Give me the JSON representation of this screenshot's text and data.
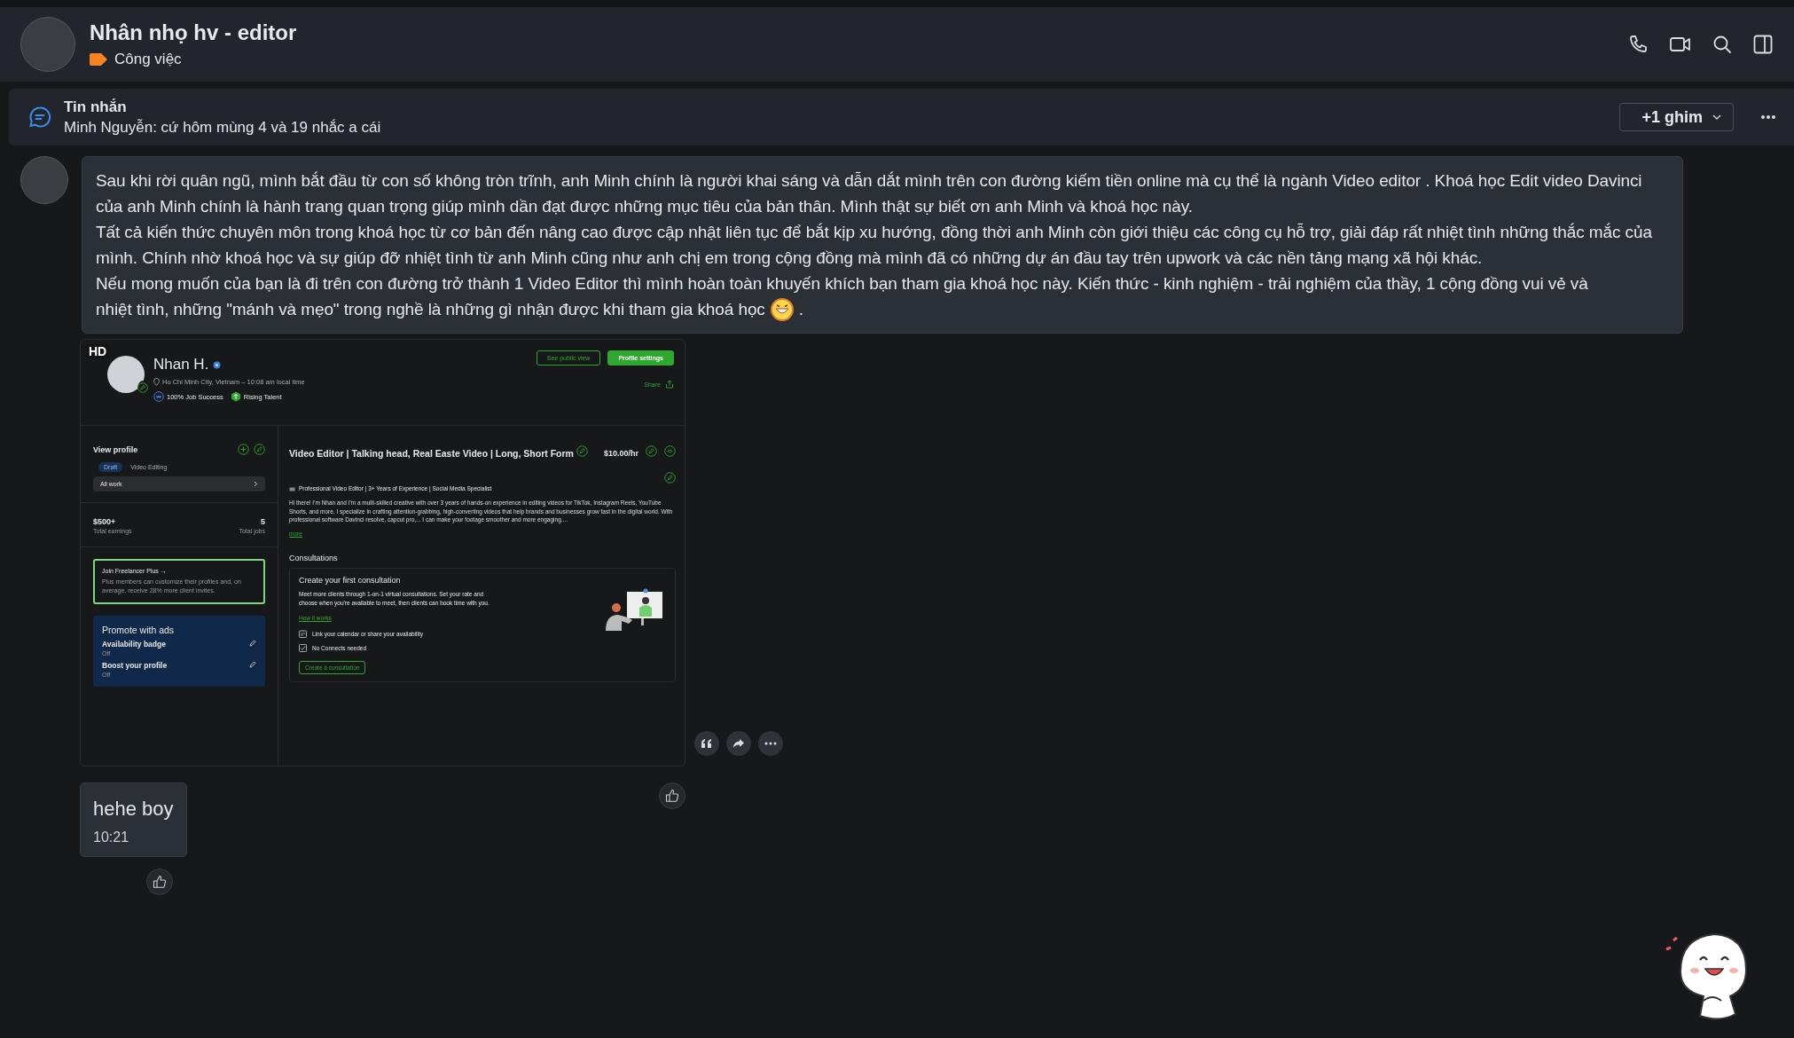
{
  "header": {
    "title": "Nhân nhọ hv - editor",
    "tag": {
      "label": "Công việc",
      "color": "#f5841f"
    }
  },
  "pinned": {
    "title": "Tin nhắn",
    "preview": "Minh Nguyễn: cứ hôm mùng 4 và 19 nhắc a cái",
    "more_pins": "+1 ghim"
  },
  "messages": [
    {
      "kind": "text",
      "paragraphs": [
        "Sau khi rời quân ngũ, mình bắt đầu từ con số không tròn trĩnh, anh Minh chính là người khai sáng và dẫn dắt mình trên con đường kiếm tiền online mà cụ thể là ngành Video editor . Khoá học Edit video Davinci của anh Minh chính là hành trang quan trọng giúp mình dần đạt được những mục tiêu của bản thân. Mình thật sự biết ơn anh Minh và khoá học này.",
        "Tất cả kiến thức chuyên môn trong khoá học từ cơ bản đến nâng cao được cập nhật liên tục để bắt kịp xu hướng, đồng thời anh Minh còn giới thiệu các công cụ hỗ trợ, giải đáp rất nhiệt tình những thắc mắc của mình. Chính nhờ khoá học và sự giúp đỡ nhiệt tình từ anh Minh cũng như anh chị em trong cộng đồng mà mình đã có những dự án đầu tay trên upwork và các nền tảng mạng xã hội khác.",
        "Nếu mong muốn của bạn là đi trên con đường trở thành 1 Video Editor thì mình hoàn toàn khuyến khích bạn tham gia khoá học này. Kiến thức - kinh nghiệm - trải nghiệm của thầy, 1 cộng đồng vui vẻ và"
      ],
      "last_line": "nhiệt tình, những \"mánh và mẹo\" trong nghề là những gì nhận được khi tham gia khoá học",
      "trailing": "."
    },
    {
      "kind": "image",
      "shot": {
        "badge": "HD",
        "name": "Nhan H.",
        "location": "Ho Chi Minh City, Vietnam – 10:08 am local time",
        "stats": [
          "100% Job Success",
          "Rising Talent"
        ],
        "buttons": [
          "See public view",
          "Profile settings"
        ],
        "share": "Share",
        "sidebar": {
          "title": "View profile",
          "draft": "Draft",
          "specialty": "Video Editing",
          "all_work": "All work",
          "earnings": {
            "value": "$500+",
            "label": "Total earnings"
          },
          "jobs": {
            "value": "5",
            "label": "Total jobs"
          },
          "plus": {
            "title": "Join Freelancer Plus →",
            "text": "Plus members can customize their profiles and, on average, receive 28% more client invites."
          },
          "promote": {
            "title": "Promote with ads",
            "items": [
              {
                "label": "Availability badge",
                "status": "Off"
              },
              {
                "label": "Boost your profile",
                "status": "Off"
              }
            ]
          }
        },
        "main": {
          "title": "Video Editor | Talking head, Real Easte Video | Long, Short Form",
          "rate": "$10.00/hr",
          "headline": "Professional Video Editor | 3+ Years of Experience | Social Media Specialist",
          "overview": "Hi there! I'm Nhan and I'm a multi-skilled creative with over 3 years of hands-on experience in editing videos for TikTok, Instagram Reels, YouTube Shorts, and more. I specialize in crafting attention-grabbing, high-converting videos that help brands and businesses grow fast in the digital world. With professional software Davinci resolve, capcut pro,... I can make your footage smoother and more engaging....",
          "more": "more",
          "consult": {
            "section": "Consultations",
            "title": "Create your first consultation",
            "text": "Meet more clients through 1-on-1 virtual consultations. Set your rate and choose when you're available to meet, then clients can book time with you.",
            "link": "How it works",
            "checklist": [
              "Link your calendar or share your availability",
              "No Connects needed"
            ],
            "button": "Create a consultation"
          }
        }
      }
    },
    {
      "kind": "short",
      "text": "hehe boy",
      "time": "10:21"
    }
  ]
}
